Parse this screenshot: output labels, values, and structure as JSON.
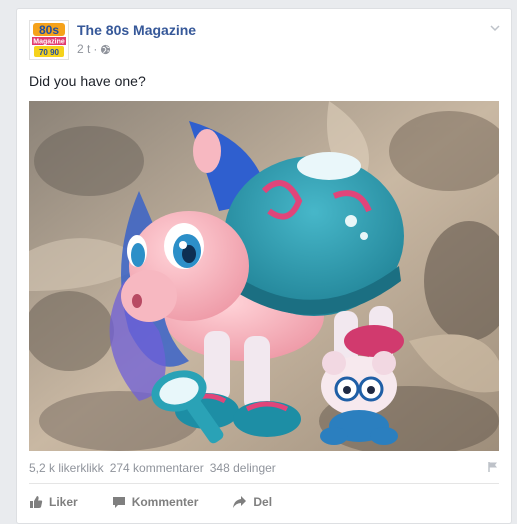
{
  "post": {
    "page_name": "The 80s Magazine",
    "time": "2 t",
    "separator": "·",
    "text": "Did you have one?",
    "avatar_logo": {
      "top": "80s",
      "middle": "Magazine",
      "bottom": "70's 90's"
    }
  },
  "stats": {
    "likes": "5,2 k likerklikk",
    "comments": "274 kommentarer",
    "shares": "348 delinger"
  },
  "actions": {
    "like": "Liker",
    "comment": "Kommenter",
    "share": "Del"
  },
  "colors": {
    "link_blue": "#365899",
    "muted": "#90949c",
    "action_gray": "#7f7f7f"
  },
  "icons": [
    "globe-icon",
    "chevron-down-icon",
    "flag-icon",
    "thumbs-up-icon",
    "comment-icon",
    "share-icon"
  ]
}
